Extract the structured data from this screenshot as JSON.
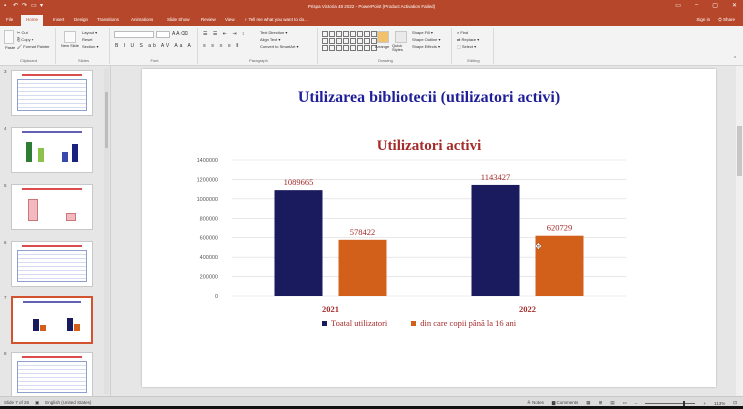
{
  "window": {
    "title": "Prispa Victoria 48 2022 - PowerPoint (Product Activation Failed)",
    "controls": [
      "▭",
      "–",
      "▢",
      "✕"
    ]
  },
  "tabs": [
    "File",
    "Home",
    "Insert",
    "Design",
    "Transitions",
    "Animations",
    "Slide Show",
    "Review",
    "View",
    "♀ Tell me what you want to do..."
  ],
  "active_tab": "Home",
  "tabs_right": [
    "Sign in",
    "⛭ Share"
  ],
  "ribbon": {
    "clipboard": {
      "cut": "✂ Cut",
      "copy": "⎘ Copy ▾",
      "paste": "Paste",
      "format_painter": "🖌 Format Painter",
      "label": "Clipboard"
    },
    "slides": {
      "new_slide": "New Slide",
      "layout": "Layout ▾",
      "reset": "Reset",
      "section": "Section ▾",
      "label": "Slides"
    },
    "font": {
      "label": "Font"
    },
    "paragraph": {
      "text_direction": "Text Direction ▾",
      "align_text": "Align Text ▾",
      "smartart": "Convert to SmartArt ▾",
      "label": "Paragraph"
    },
    "drawing": {
      "arrange": "Arrange",
      "quick_styles": "Quick Styles",
      "shape_fill": "Shape Fill ▾",
      "shape_outline": "Shape Outline ▾",
      "shape_effects": "Shape Effects ▾",
      "label": "Drawing"
    },
    "editing": {
      "find": "⌕ Find",
      "replace": "⇄ Replace ▾",
      "select": "⬚ Select ▾",
      "label": "Editing"
    }
  },
  "thumbnails": [
    {
      "number": "3"
    },
    {
      "number": "4"
    },
    {
      "number": "5"
    },
    {
      "number": "6"
    },
    {
      "number": "7"
    },
    {
      "number": "8"
    }
  ],
  "slide": {
    "title": "Utilizarea bibliotecii (utilizatori activi)"
  },
  "chart_data": {
    "type": "bar",
    "title": "Utilizatori activi",
    "categories": [
      "2021",
      "2022"
    ],
    "series": [
      {
        "name": "Toatal utilizatori",
        "values": [
          1089665,
          1143427
        ],
        "color": "#1a1a5e"
      },
      {
        "name": "din care copii până la 16 ani",
        "values": [
          578422,
          620729
        ],
        "color": "#d2601a"
      }
    ],
    "ylim": [
      0,
      1400000
    ],
    "yticks": [
      "1400000",
      "1200000",
      "1000000",
      "800000",
      "600000",
      "400000",
      "200000",
      "0"
    ],
    "data_label_color": "#a52a2a",
    "legend": "bottom",
    "grid": true
  },
  "status": {
    "slide_of": "Slide 7 of 26",
    "language": "English (United States)",
    "notes": "≜ Notes",
    "comments": "▆ Comments",
    "zoom": "113%"
  }
}
